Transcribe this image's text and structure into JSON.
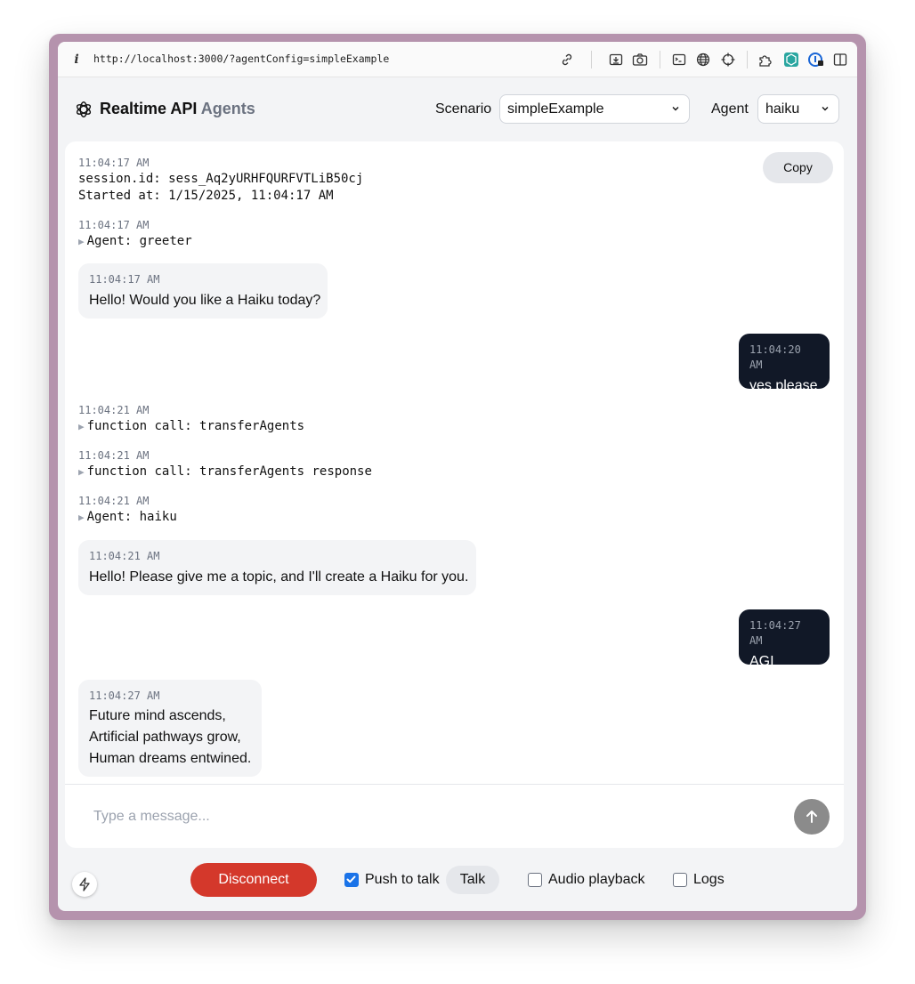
{
  "browser": {
    "url": "http://localhost:3000/?agentConfig=simpleExample"
  },
  "header": {
    "title": "Realtime API",
    "title_suffix": "Agents",
    "scenario_label": "Scenario",
    "scenario_value": "simpleExample",
    "agent_label": "Agent",
    "agent_value": "haiku"
  },
  "transcript": {
    "copy_label": "Copy",
    "session": {
      "time": "11:04:17 AM",
      "id_line": "session.id: sess_Aq2yURHFQURFVTLiB50cj",
      "started_line": "Started at: 1/15/2025, 11:04:17 AM"
    },
    "logs": [
      {
        "time": "11:04:17 AM",
        "text": "Agent: greeter"
      },
      {
        "time": "11:04:21 AM",
        "text": "function call: transferAgents"
      },
      {
        "time": "11:04:21 AM",
        "text": "function call: transferAgents response"
      },
      {
        "time": "11:04:21 AM",
        "text": "Agent: haiku"
      }
    ],
    "messages": [
      {
        "role": "assistant",
        "time": "11:04:17 AM",
        "text": "Hello! Would you like a Haiku today?"
      },
      {
        "role": "user",
        "time": "11:04:20 AM",
        "text": "yes please"
      },
      {
        "role": "assistant",
        "time": "11:04:21 AM",
        "text": "Hello! Please give me a topic, and I'll create a Haiku for you."
      },
      {
        "role": "user",
        "time": "11:04:27 AM",
        "text": "AGI"
      },
      {
        "role": "assistant",
        "time": "11:04:27 AM",
        "lines": [
          "Future mind ascends,",
          "Artificial pathways grow,",
          "Human dreams entwined."
        ]
      }
    ],
    "input_placeholder": "Type a message..."
  },
  "bottom_toolbar": {
    "disconnect_label": "Disconnect",
    "push_to_talk_label": "Push to talk",
    "push_to_talk_checked": true,
    "talk_label": "Talk",
    "audio_playback_label": "Audio playback",
    "audio_playback_checked": false,
    "logs_label": "Logs",
    "logs_checked": false
  },
  "colors": {
    "accent_red": "#d4382b",
    "user_bubble": "#111827",
    "assistant_bubble": "#f3f4f6",
    "window_frame": "#b593ad"
  }
}
